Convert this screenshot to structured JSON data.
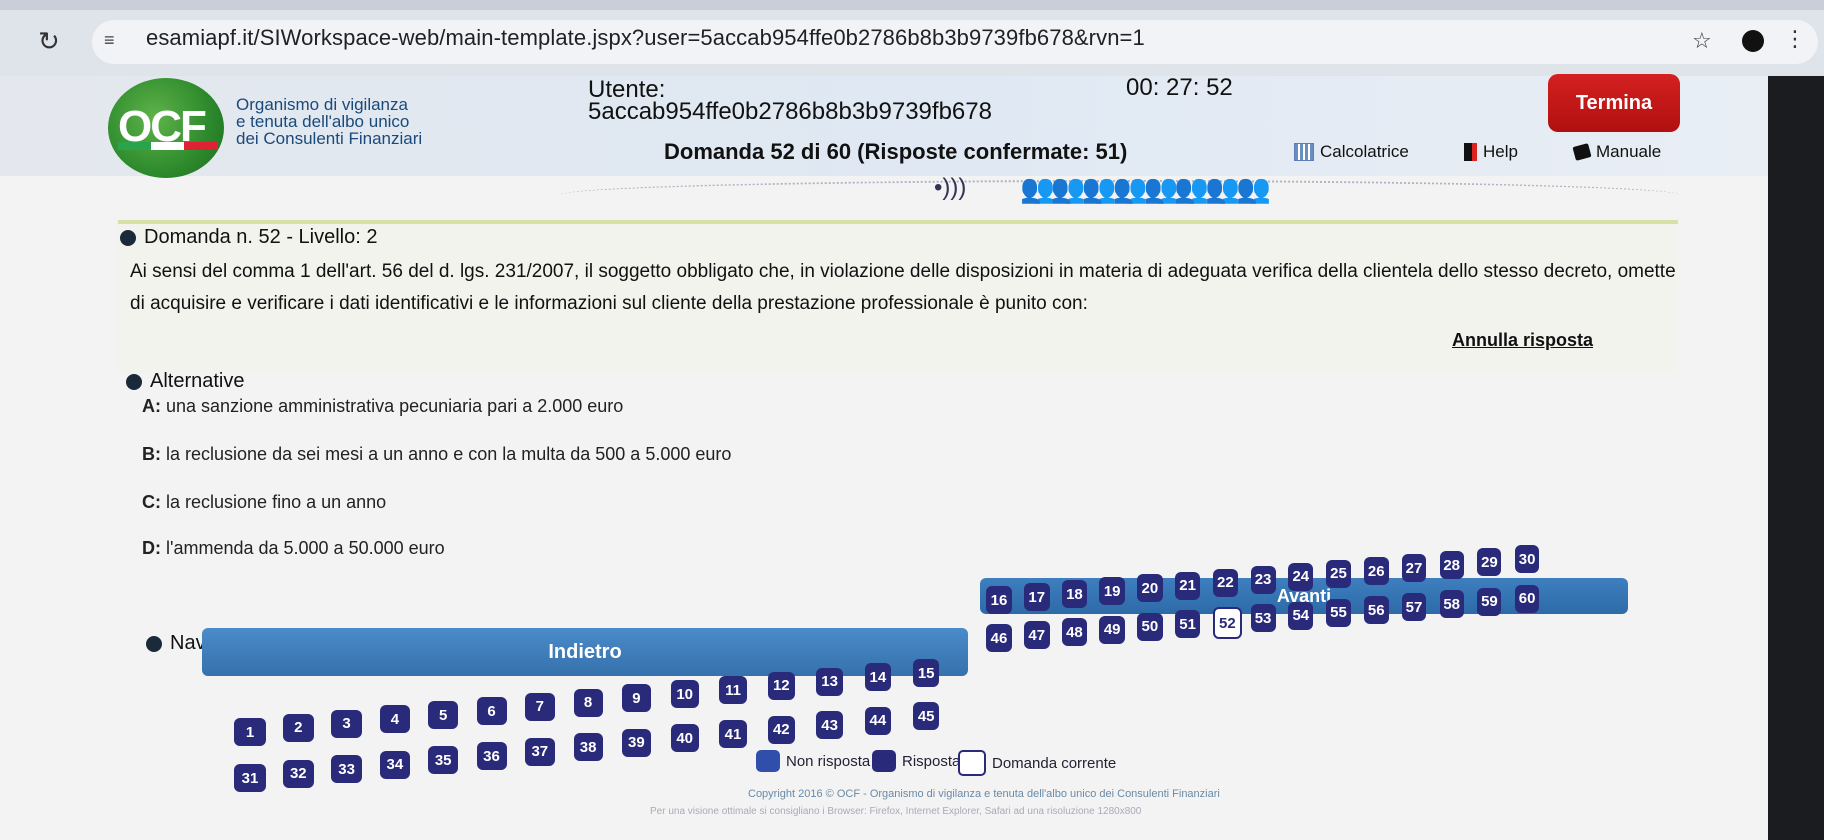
{
  "browser": {
    "url": "esamiapf.it/SIWorkspace-web/main-template.jspx?user=5accab954ffe0b2786b8b3b9739fb678&rvn=1"
  },
  "header": {
    "logo_text": "OCF",
    "org_line1": "Organismo di vigilanza",
    "org_line2": "e tenuta dell'albo unico",
    "org_line3": "dei Consulenti Finanziari",
    "utente_label": "Utente:",
    "utente_id": "5accab954ffe0b2786b8b3b9739fb678",
    "timer": "00: 27: 52",
    "termina_label": "Termina",
    "question_counter": "Domanda 52 di 60 (Risposte confermate: 51)",
    "calcolatrice_label": "Calcolatrice",
    "help_label": "Help",
    "manuale_label": "Manuale"
  },
  "question": {
    "title": "Domanda n. 52 - Livello: 2",
    "text": "Ai sensi del comma 1 dell'art. 56 del d. lgs. 231/2007, il soggetto obbligato che, in violazione delle disposizioni in materia di adeguata verifica della clientela dello stesso decreto, omette di acquisire e verificare i dati identificativi e le informazioni sul cliente della prestazione professionale è punito con:",
    "annulla_label": "Annulla risposta"
  },
  "alternatives": {
    "title": "Alternative",
    "items": [
      {
        "letter": "A:",
        "text": "una sanzione amministrativa pecuniaria pari a 2.000 euro"
      },
      {
        "letter": "B:",
        "text": "la reclusione da sei mesi a un anno e con la multa da 500 a 5.000 euro"
      },
      {
        "letter": "C:",
        "text": "la reclusione fino a un anno"
      },
      {
        "letter": "D:",
        "text": "l'ammenda da 5.000 a 50.000 euro"
      }
    ]
  },
  "navigation": {
    "title": "Navigazione",
    "avanti_label": "Avanti",
    "indietro_label": "Indietro",
    "current_question": 52,
    "legend": {
      "non_risposta": "Non risposta",
      "risposta": "Risposta",
      "domanda_corrente": "Domanda corrente"
    }
  },
  "footer": {
    "copyright": "Copyright 2016 © OCF - Organismo di vigilanza e tenuta dell'albo unico dei Consulenti Finanziari",
    "note": "Per una visione ottimale si consigliano i Browser: Firefox, Internet Explorer, Safari ad una risoluzione 1280x800"
  },
  "colors": {
    "termina": "#c81818",
    "nav_button": "#3a78b8",
    "question_button": "#3a2f6d"
  }
}
